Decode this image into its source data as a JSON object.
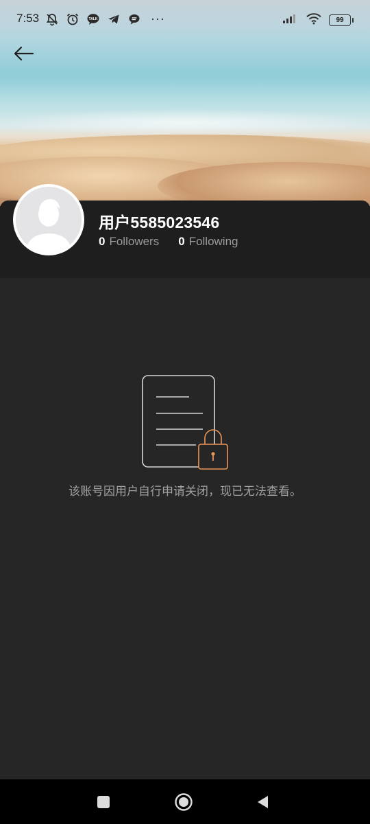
{
  "status_bar": {
    "time": "7:53",
    "left_icons": [
      "notifications-off-icon",
      "alarm-icon",
      "talk-icon",
      "telegram-icon",
      "chat-bubble-icon",
      "more-icon"
    ],
    "more_label": "···",
    "right_icons": [
      "signal-icon",
      "wifi-icon",
      "battery-icon"
    ],
    "battery": "99"
  },
  "header": {
    "back_icon": "arrow-left-icon"
  },
  "profile": {
    "username": "用户5585023546",
    "followers_count": "0",
    "followers_label": "Followers",
    "following_count": "0",
    "following_label": "Following"
  },
  "content": {
    "illustration_icon": "document-lock-icon",
    "message": "该账号因用户自行申请关闭，现已无法查看。",
    "lock_color": "#e8955a"
  },
  "nav_bar": {
    "buttons": [
      "recents-square-icon",
      "home-circle-icon",
      "back-triangle-icon"
    ]
  }
}
